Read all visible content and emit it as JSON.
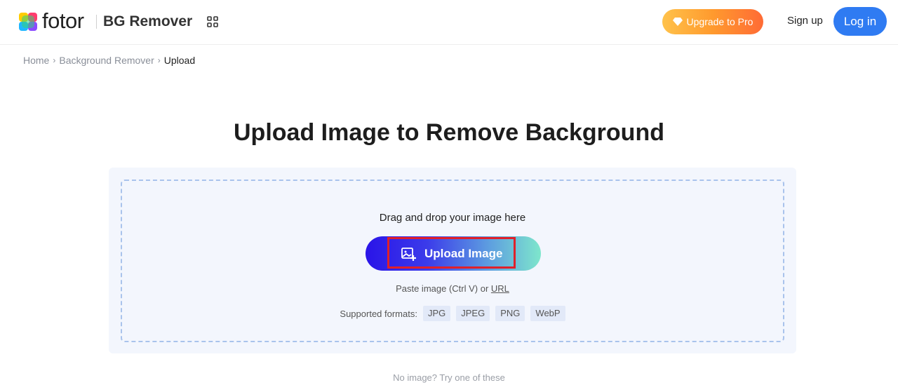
{
  "header": {
    "logo_text": "fotor",
    "product_name": "BG Remover",
    "upgrade_label": "Upgrade to Pro",
    "signup_label": "Sign up",
    "login_label": "Log in"
  },
  "breadcrumb": {
    "items": [
      "Home",
      "Background Remover",
      "Upload"
    ]
  },
  "main": {
    "title": "Upload Image to Remove Background",
    "dropzone": {
      "drag_text": "Drag and drop your image here",
      "upload_label": "Upload Image",
      "paste_prefix": "Paste image (Ctrl V) or ",
      "url_label": "URL",
      "formats_label": "Supported formats:",
      "formats": [
        "JPG",
        "JPEG",
        "PNG",
        "WebP"
      ]
    },
    "samples_label": "No image? Try one of these"
  },
  "colors": {
    "brand_blue": "#2f7bf2",
    "upgrade_gradient_start": "#ffc24a",
    "upgrade_gradient_end": "#ff6b35",
    "upload_gradient_start": "#2a14e8",
    "upload_gradient_end": "#7ee6cc",
    "highlight_red": "#e0202a"
  },
  "icons": {
    "logo": "fotor-logo-icon",
    "apps": "apps-grid-icon",
    "upgrade": "diamond-icon",
    "upload": "image-add-icon"
  }
}
